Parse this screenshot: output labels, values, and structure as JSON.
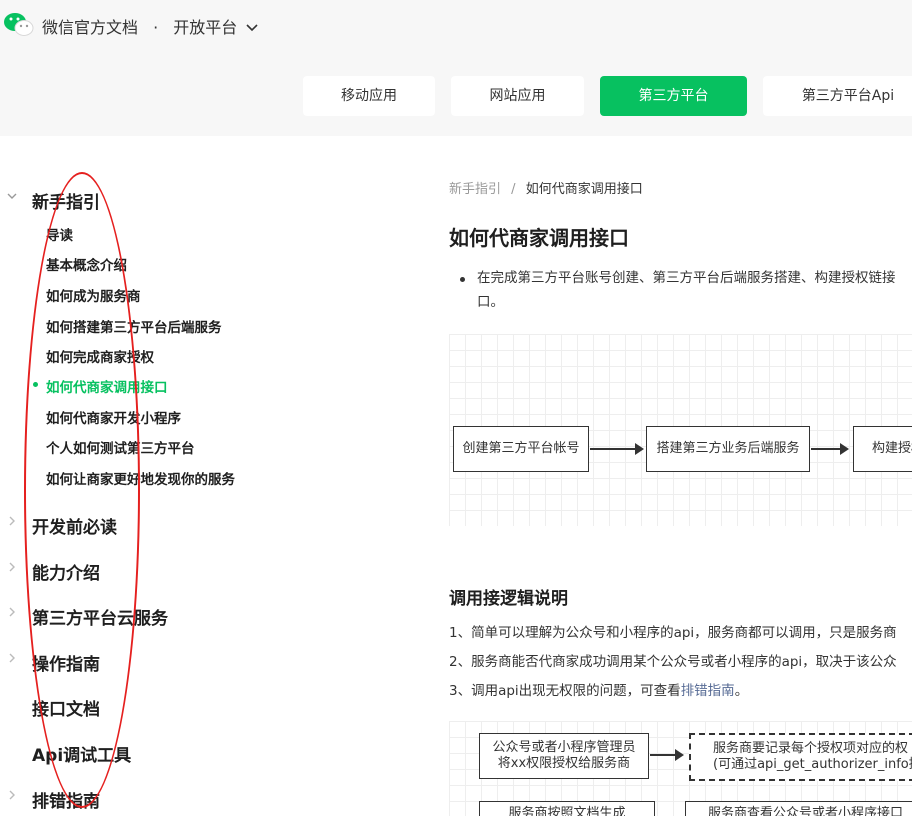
{
  "header": {
    "brand": "微信官方文档",
    "separator": "·",
    "platform": "开放平台",
    "logo_icon": "wechat-logo-icon",
    "dropdown_icon": "chevron-down-icon"
  },
  "tabs": [
    {
      "label": "移动应用",
      "active": false
    },
    {
      "label": "网站应用",
      "active": false
    },
    {
      "label": "第三方平台",
      "active": true
    },
    {
      "label": "第三方平台Api",
      "active": false
    }
  ],
  "colors": {
    "accent": "#07c160",
    "annotation": "#e5201f",
    "link": "#576b95"
  },
  "sidebar": {
    "sections": [
      {
        "label": "新手指引",
        "expanded": true
      },
      {
        "label": "开发前必读",
        "expanded": false
      },
      {
        "label": "能力介绍",
        "expanded": false
      },
      {
        "label": "第三方平台云服务",
        "expanded": false
      },
      {
        "label": "操作指南",
        "expanded": false
      },
      {
        "label": "接口文档",
        "expanded": false
      },
      {
        "label": "Api调试工具",
        "expanded": false
      },
      {
        "label": "排错指南",
        "expanded": false
      }
    ],
    "items": [
      {
        "label": "导读"
      },
      {
        "label": "基本概念介绍"
      },
      {
        "label": "如何成为服务商"
      },
      {
        "label": "如何搭建第三方平台后端服务"
      },
      {
        "label": "如何完成商家授权"
      },
      {
        "label": "如何代商家调用接口",
        "active": true
      },
      {
        "label": "如何代商家开发小程序"
      },
      {
        "label": "个人如何测试第三方平台"
      },
      {
        "label": "如何让商家更好地发现你的服务"
      }
    ]
  },
  "main": {
    "breadcrumb": {
      "parent": "新手指引",
      "separator": "/",
      "current": "如何代商家调用接口"
    },
    "title": "如何代商家调用接口",
    "intro_line1": "在完成第三方平台账号创建、第三方平台后端服务搭建、构建授权链接",
    "intro_line2": "口。",
    "flow": [
      "创建第三方平台帐号",
      "搭建第三方业务后端服务",
      "构建授权"
    ],
    "section_title": "调用接逻辑说明",
    "lines": [
      "1、简单可以理解为公众号和小程序的api，服务商都可以调用，只是服务商",
      "2、服务商能否代商家成功调用某个公众号或者小程序的api，取决于该公众",
      "3、调用api出现无权限的问题，可查看"
    ],
    "link_text": "排错指南",
    "line3_suffix": "。",
    "flow2": {
      "box1_line1": "公众号或者小程序管理员",
      "box1_line2": "将xx权限授权给服务商",
      "box2_line1": "服务商要记录每个授权项对应的权",
      "box2_line2": "(可通过api_get_authorizer_info接",
      "box3": "服务商按照文档生成",
      "box4": "服务商查看公众号或者小程序接口"
    }
  }
}
